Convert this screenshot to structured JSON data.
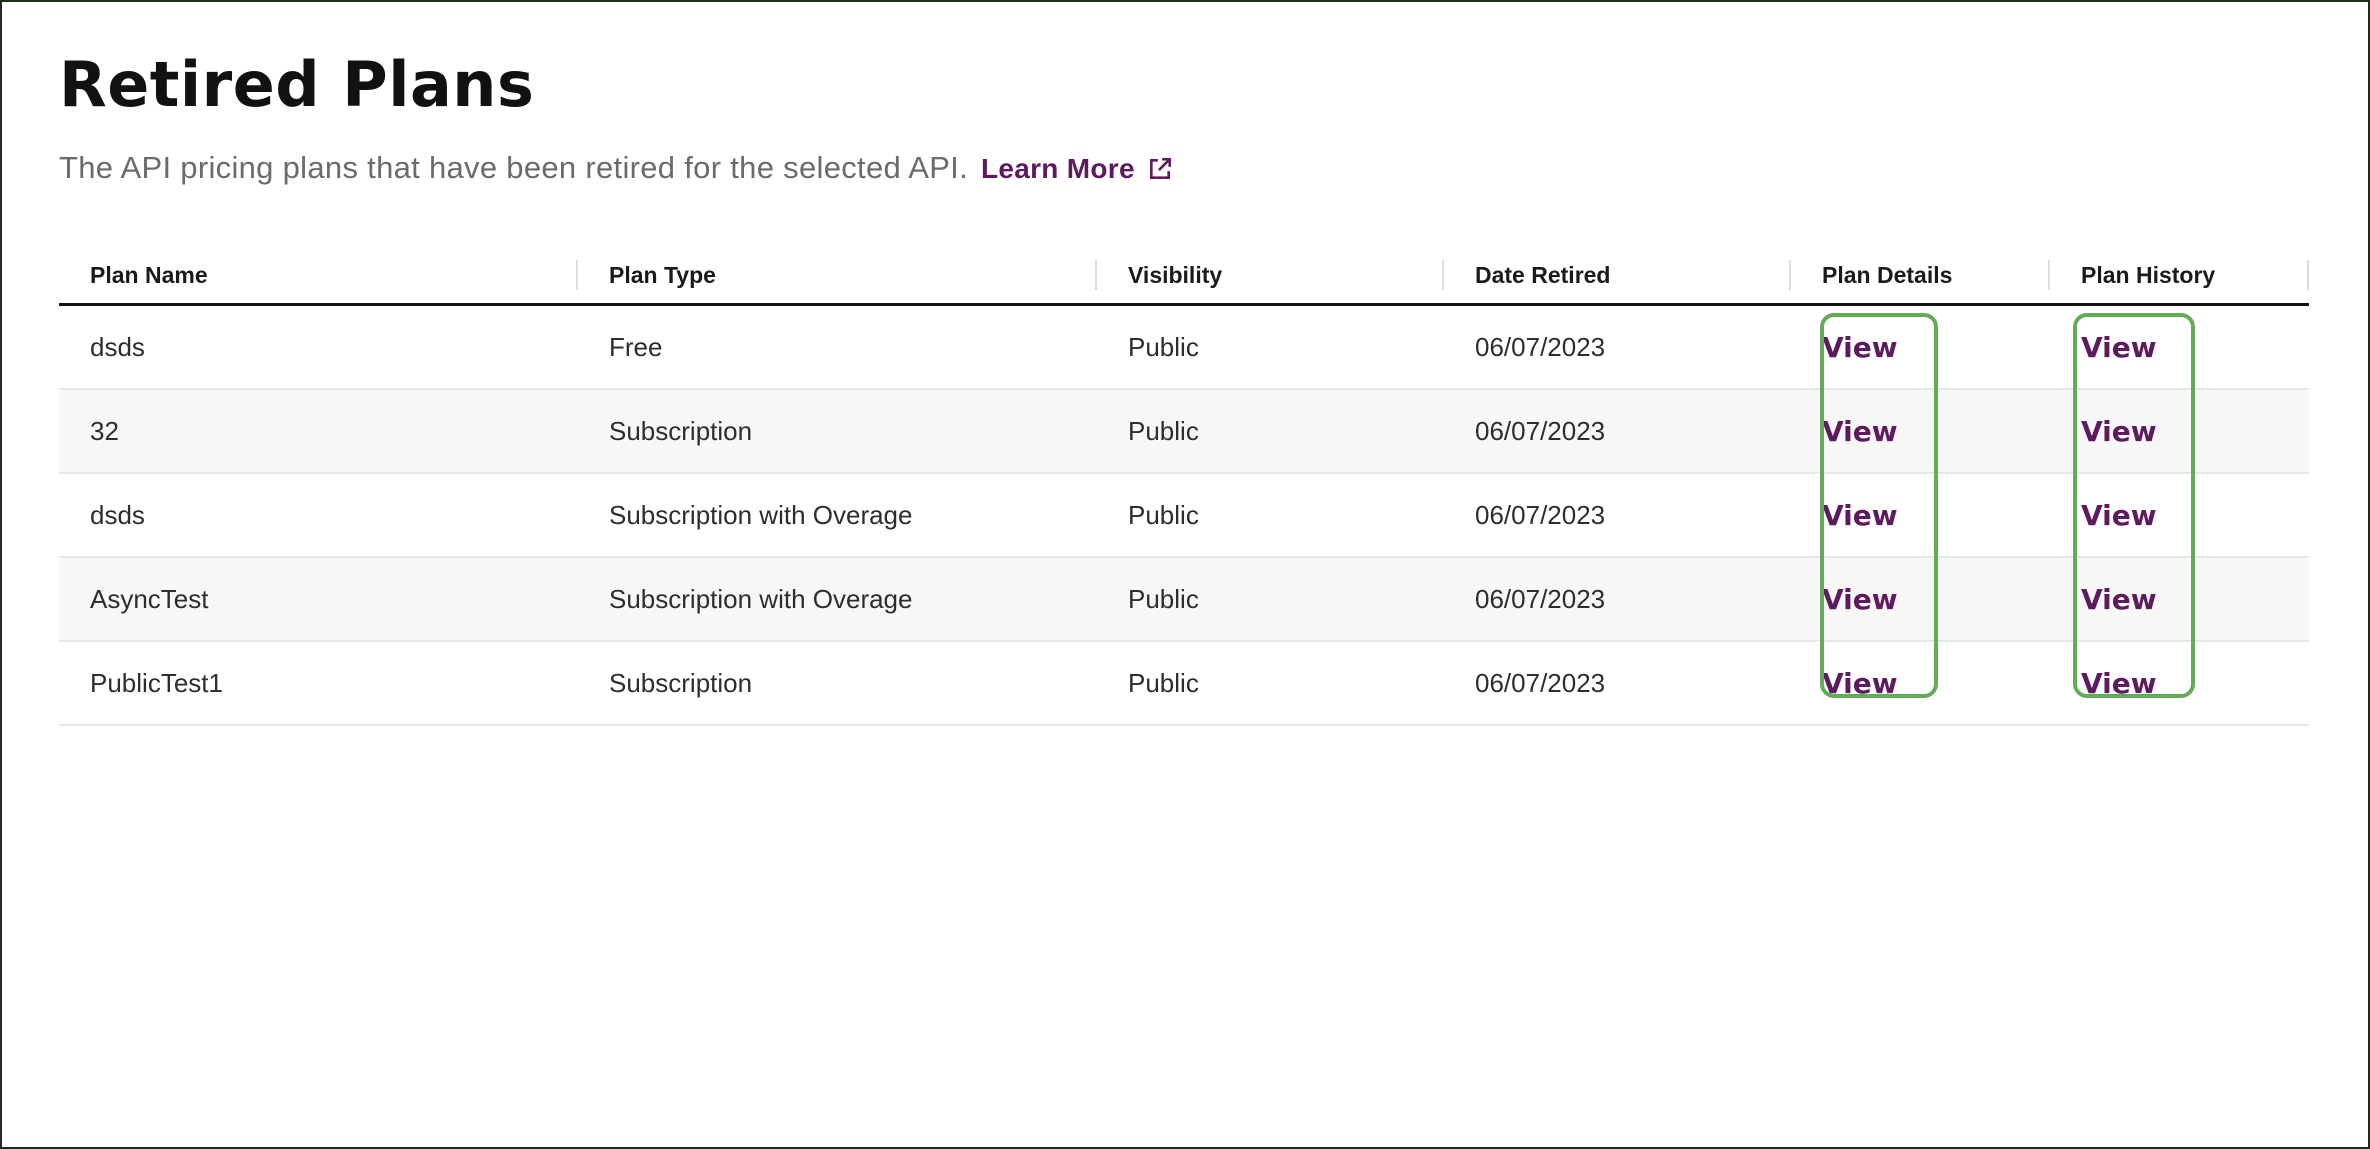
{
  "header": {
    "title": "Retired Plans",
    "subtitle": "The API pricing plans that have been retired for the selected API.",
    "learn_more": "Learn More",
    "learn_more_icon": "external-link-icon"
  },
  "table": {
    "columns": [
      "Plan Name",
      "Plan Type",
      "Visibility",
      "Date Retired",
      "Plan Details",
      "Plan History"
    ],
    "rows": [
      {
        "name": "dsds",
        "type": "Free",
        "visibility": "Public",
        "date": "06/07/2023",
        "details": "View",
        "history": "View"
      },
      {
        "name": "32",
        "type": "Subscription",
        "visibility": "Public",
        "date": "06/07/2023",
        "details": "View",
        "history": "View"
      },
      {
        "name": "dsds",
        "type": "Subscription with Overage",
        "visibility": "Public",
        "date": "06/07/2023",
        "details": "View",
        "history": "View"
      },
      {
        "name": "AsyncTest",
        "type": "Subscription with Overage",
        "visibility": "Public",
        "date": "06/07/2023",
        "details": "View",
        "history": "View"
      },
      {
        "name": "PublicTest1",
        "type": "Subscription",
        "visibility": "Public",
        "date": "06/07/2023",
        "details": "View",
        "history": "View"
      }
    ]
  },
  "colors": {
    "accent": "#5d1a5e",
    "highlight": "#63ac56",
    "row_alt": "#f7f7f7"
  }
}
